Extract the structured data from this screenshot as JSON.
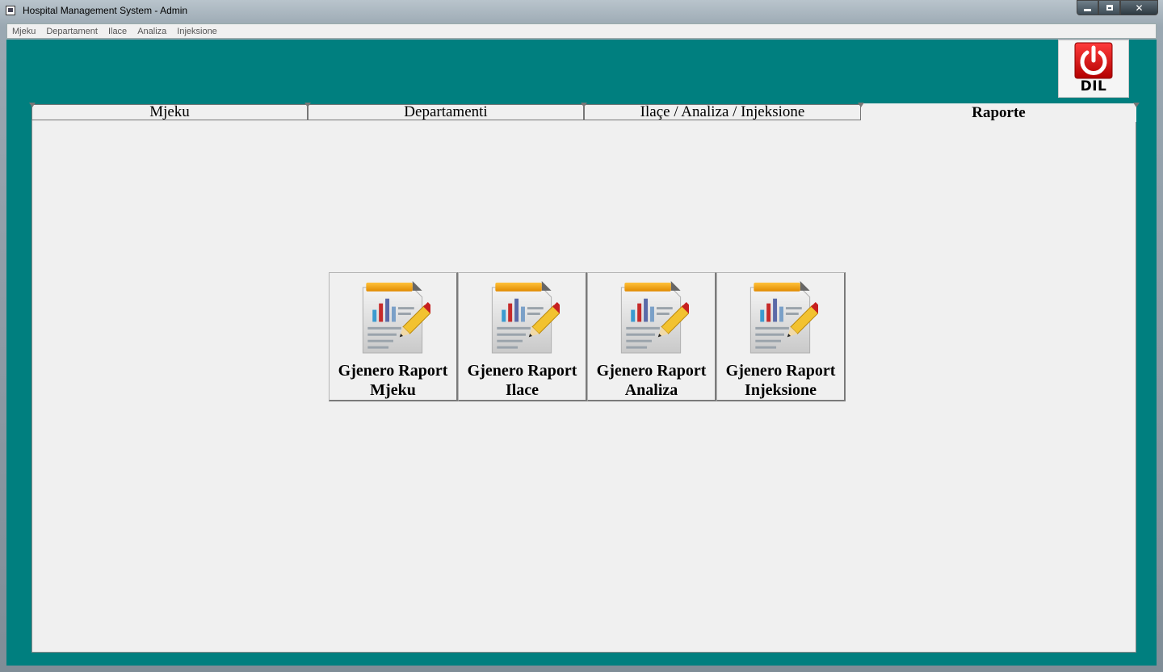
{
  "window": {
    "title": "Hospital Management System - Admin",
    "caption_buttons": {
      "close": "✕"
    }
  },
  "menubar": {
    "items": [
      "Mjeku",
      "Departament",
      "Ilace",
      "Analiza",
      "Injeksione"
    ]
  },
  "exit_button": {
    "label": "DIL",
    "icon": "power-icon"
  },
  "tabs": [
    {
      "label": "Mjeku",
      "active": false
    },
    {
      "label": "Departamenti",
      "active": false
    },
    {
      "label": "Ilaçe / Analiza / Injeksione",
      "active": false
    },
    {
      "label": "Raporte",
      "active": true
    }
  ],
  "reports": [
    {
      "line1": "Gjenero Raport",
      "line2": "Mjeku",
      "icon": "report-edit-icon"
    },
    {
      "line1": "Gjenero Raport",
      "line2": "Ilace",
      "icon": "report-edit-icon"
    },
    {
      "line1": "Gjenero Raport",
      "line2": "Analiza",
      "icon": "report-edit-icon"
    },
    {
      "line1": "Gjenero Raport",
      "line2": "Injeksione",
      "icon": "report-edit-icon"
    }
  ],
  "colors": {
    "client_bg": "#007f7f",
    "panel_bg": "#f0f0f0",
    "power_red": "#d40000"
  }
}
